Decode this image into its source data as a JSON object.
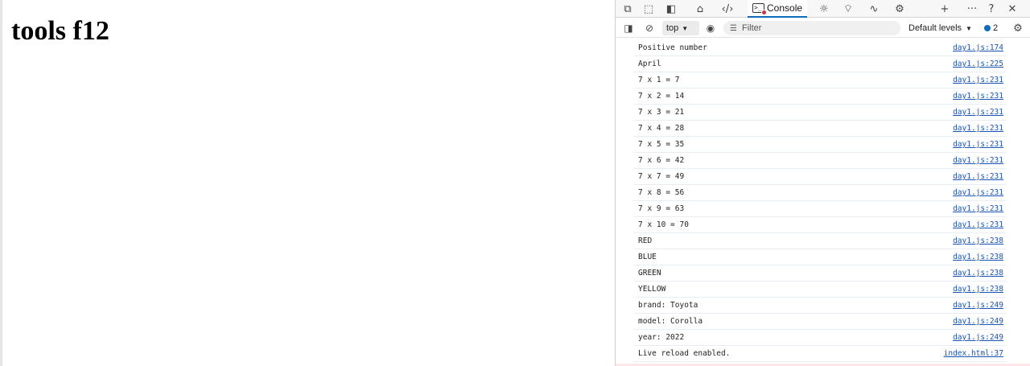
{
  "page": {
    "heading": "tools f12"
  },
  "devtools": {
    "tabs": [
      {
        "icon": "device-emulation-icon",
        "glyph": "⧉"
      },
      {
        "icon": "inspect-icon",
        "glyph": "⬚"
      },
      {
        "icon": "dock-panel-icon",
        "glyph": "◧"
      },
      {
        "icon": "welcome-home-icon",
        "glyph": "⌂"
      },
      {
        "icon": "elements-icon",
        "glyph": "‹/›"
      }
    ],
    "active_tab": {
      "label": "Console"
    },
    "right_tabs": [
      {
        "icon": "sources-bug-icon",
        "glyph": "☼"
      },
      {
        "icon": "network-wifi-icon",
        "glyph": "⌔"
      },
      {
        "icon": "performance-icon",
        "glyph": "∿"
      },
      {
        "icon": "settings-gear-icon",
        "glyph": "⚙"
      },
      {
        "icon": "add-tool-icon",
        "glyph": "+"
      },
      {
        "icon": "more-icon",
        "glyph": "···"
      },
      {
        "icon": "help-icon",
        "glyph": "?"
      },
      {
        "icon": "close-icon",
        "glyph": "✕"
      }
    ],
    "toolbar": {
      "context": "top",
      "filter_placeholder": "Filter",
      "levels": "Default levels",
      "issues_count": "2"
    },
    "messages": [
      {
        "text": "Positive number",
        "source": "day1.js:174"
      },
      {
        "text": "April",
        "source": "day1.js:225"
      },
      {
        "text": "7 x 1 = 7",
        "source": "day1.js:231"
      },
      {
        "text": "7 x 2 = 14",
        "source": "day1.js:231"
      },
      {
        "text": "7 x 3 = 21",
        "source": "day1.js:231"
      },
      {
        "text": "7 x 4 = 28",
        "source": "day1.js:231"
      },
      {
        "text": "7 x 5 = 35",
        "source": "day1.js:231"
      },
      {
        "text": "7 x 6 = 42",
        "source": "day1.js:231"
      },
      {
        "text": "7 x 7 = 49",
        "source": "day1.js:231"
      },
      {
        "text": "7 x 8 = 56",
        "source": "day1.js:231"
      },
      {
        "text": "7 x 9 = 63",
        "source": "day1.js:231"
      },
      {
        "text": "7 x 10 = 70",
        "source": "day1.js:231"
      },
      {
        "text": "RED",
        "source": "day1.js:238"
      },
      {
        "text": "BLUE",
        "source": "day1.js:238"
      },
      {
        "text": "GREEN",
        "source": "day1.js:238"
      },
      {
        "text": "YELLOW",
        "source": "day1.js:238"
      },
      {
        "text": "brand: Toyota",
        "source": "day1.js:249"
      },
      {
        "text": "model: Corolla",
        "source": "day1.js:249"
      },
      {
        "text": "year: 2022",
        "source": "day1.js:249"
      },
      {
        "text": "Live reload enabled.",
        "source": "index.html:37"
      }
    ]
  }
}
